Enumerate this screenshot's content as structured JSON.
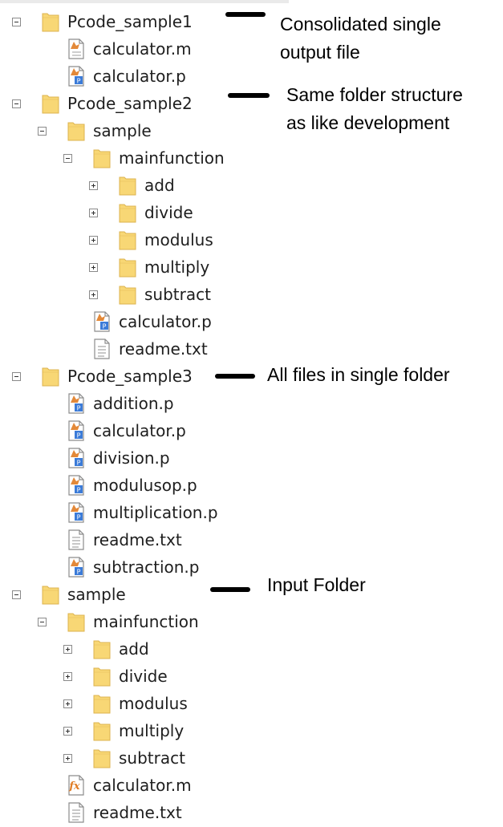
{
  "tree": [
    {
      "label": "Pcode_sample1",
      "icon": "folder-icon",
      "expander": "expanded",
      "depth": 0
    },
    {
      "label": "calculator.m",
      "icon": "m-file-icon",
      "expander": "none",
      "depth": 1
    },
    {
      "label": "calculator.p",
      "icon": "p-file-icon",
      "expander": "none",
      "depth": 1
    },
    {
      "label": "Pcode_sample2",
      "icon": "folder-icon",
      "expander": "expanded",
      "depth": 0
    },
    {
      "label": "sample",
      "icon": "folder-icon",
      "expander": "expanded",
      "depth": 1
    },
    {
      "label": "mainfunction",
      "icon": "folder-icon",
      "expander": "expanded",
      "depth": 2
    },
    {
      "label": "add",
      "icon": "folder-icon",
      "expander": "collapsed",
      "depth": 3
    },
    {
      "label": "divide",
      "icon": "folder-icon",
      "expander": "collapsed",
      "depth": 3
    },
    {
      "label": "modulus",
      "icon": "folder-icon",
      "expander": "collapsed",
      "depth": 3
    },
    {
      "label": "multiply",
      "icon": "folder-icon",
      "expander": "collapsed",
      "depth": 3
    },
    {
      "label": "subtract",
      "icon": "folder-icon",
      "expander": "collapsed",
      "depth": 3
    },
    {
      "label": "calculator.p",
      "icon": "p-file-icon",
      "expander": "none",
      "depth": 2
    },
    {
      "label": "readme.txt",
      "icon": "text-file-icon",
      "expander": "none",
      "depth": 2
    },
    {
      "label": "Pcode_sample3",
      "icon": "folder-icon",
      "expander": "expanded",
      "depth": 0
    },
    {
      "label": "addition.p",
      "icon": "p-file-icon",
      "expander": "none",
      "depth": 1
    },
    {
      "label": "calculator.p",
      "icon": "p-file-icon",
      "expander": "none",
      "depth": 1
    },
    {
      "label": "division.p",
      "icon": "p-file-icon",
      "expander": "none",
      "depth": 1
    },
    {
      "label": "modulusop.p",
      "icon": "p-file-icon",
      "expander": "none",
      "depth": 1
    },
    {
      "label": "multiplication.p",
      "icon": "p-file-icon",
      "expander": "none",
      "depth": 1
    },
    {
      "label": "readme.txt",
      "icon": "text-file-icon",
      "expander": "none",
      "depth": 1
    },
    {
      "label": "subtraction.p",
      "icon": "p-file-icon",
      "expander": "none",
      "depth": 1
    },
    {
      "label": "sample",
      "icon": "folder-icon",
      "expander": "expanded",
      "depth": 0
    },
    {
      "label": "mainfunction",
      "icon": "folder-icon",
      "expander": "expanded",
      "depth": 1
    },
    {
      "label": "add",
      "icon": "folder-icon",
      "expander": "collapsed",
      "depth": 2
    },
    {
      "label": "divide",
      "icon": "folder-icon",
      "expander": "collapsed",
      "depth": 2
    },
    {
      "label": "modulus",
      "icon": "folder-icon",
      "expander": "collapsed",
      "depth": 2
    },
    {
      "label": "multiply",
      "icon": "folder-icon",
      "expander": "collapsed",
      "depth": 2
    },
    {
      "label": "subtract",
      "icon": "folder-icon",
      "expander": "collapsed",
      "depth": 2
    },
    {
      "label": "calculator.m",
      "icon": "m-function-icon",
      "expander": "none",
      "depth": 1
    },
    {
      "label": "readme.txt",
      "icon": "text-file-icon",
      "expander": "none",
      "depth": 1
    }
  ],
  "annotations": [
    {
      "line1": "Consolidated single",
      "line2": "output file"
    },
    {
      "line1": "Same folder structure",
      "line2": "as like development"
    },
    {
      "line1": "All files in single folder",
      "line2": ""
    },
    {
      "line1": "Input Folder",
      "line2": ""
    }
  ],
  "colors": {
    "folder": "#f8d775",
    "folder_edge": "#dcb34f",
    "text": "#1e1e1e",
    "annotation": "#000000",
    "p_badge": "#3b7bd8",
    "matlab_accent": "#e07c24"
  }
}
